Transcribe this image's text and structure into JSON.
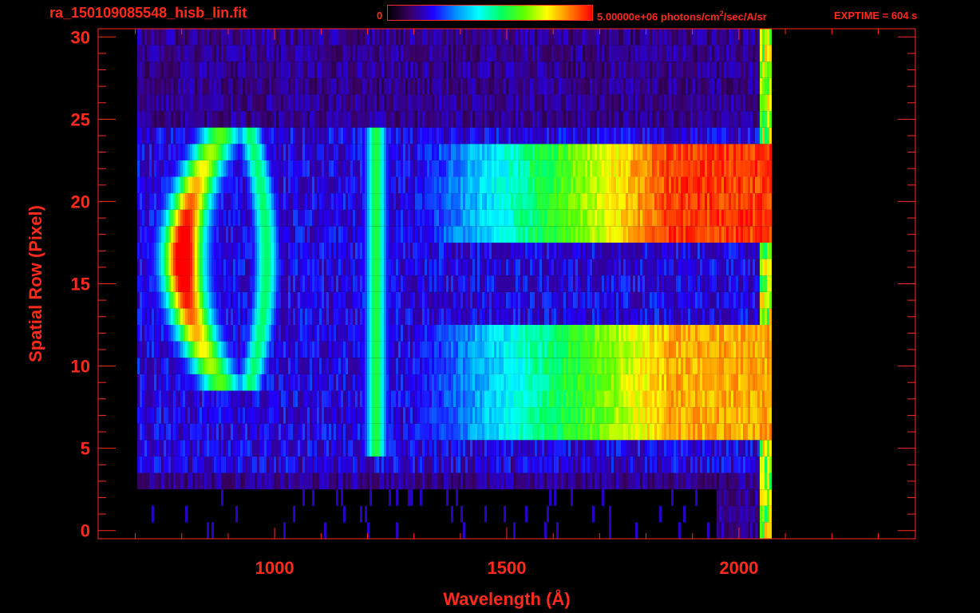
{
  "header": {
    "filename": "ra_150109085548_hisb_lin.fit",
    "colorbar_min": "0",
    "colorbar_max_prefix": "5.00000e+06 photons/cm",
    "colorbar_max_sup": "2",
    "colorbar_max_suffix": "/sec/A/sr",
    "exptime": "EXPTIME = 604 s"
  },
  "colors": {
    "axis": "#ff2a1a",
    "colormap": [
      "#000000",
      "#3a0066",
      "#2000ff",
      "#0090ff",
      "#00ffff",
      "#00ff60",
      "#60ff00",
      "#ffff00",
      "#ff8000",
      "#ff0000"
    ]
  },
  "chart_data": {
    "type": "heatmap",
    "title": "",
    "xlabel": "Wavelength (Å)",
    "ylabel": "Spatial Row (Pixel)",
    "xlim": [
      620,
      2380
    ],
    "ylim": [
      -0.5,
      30.5
    ],
    "x_ticks": [
      1000,
      1500,
      2000
    ],
    "x_tick_labels": [
      "1000",
      "1500",
      "2000"
    ],
    "y_ticks": [
      0,
      5,
      10,
      15,
      20,
      25,
      30
    ],
    "y_tick_labels": [
      "0",
      "5",
      "10",
      "15",
      "20",
      "25",
      "30"
    ],
    "colorbar_range": [
      0,
      5000000
    ],
    "rows": 31,
    "data_extent_wavelength": [
      700,
      2070
    ],
    "features": [
      {
        "name": "arc-feature",
        "wavelength_range": [
          780,
          980
        ],
        "row_range": [
          9,
          23
        ],
        "peak_rows": [
          14,
          19
        ],
        "peak_level": 1.0
      },
      {
        "name": "lyman-alpha-line",
        "wavelength_center": 1216,
        "row_range": [
          5,
          24
        ],
        "peak_level": 0.45
      },
      {
        "name": "upper-continuum-band",
        "wavelength_range": [
          1200,
          2070
        ],
        "row_range": [
          18,
          23
        ],
        "peak_level": 0.75
      },
      {
        "name": "lower-continuum-band",
        "wavelength_range": [
          1200,
          2070
        ],
        "row_range": [
          6,
          12
        ],
        "peak_level": 0.65
      }
    ]
  }
}
